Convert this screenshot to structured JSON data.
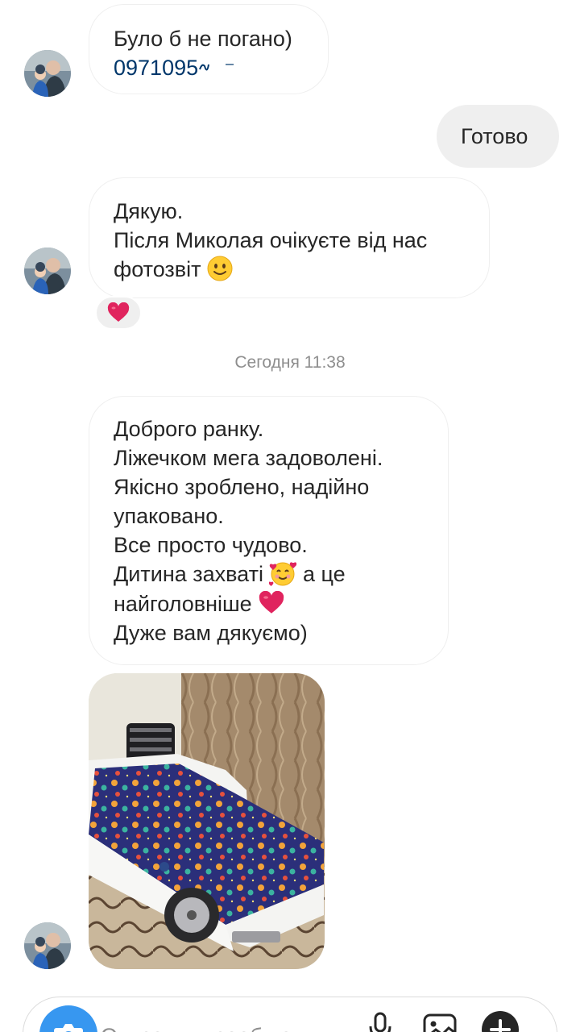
{
  "thread": {
    "messages": [
      {
        "direction": "incoming",
        "lines": [
          "Було б не погано)"
        ],
        "phone_visible": "0971095"
      },
      {
        "direction": "outgoing",
        "text": "Готово"
      },
      {
        "direction": "incoming",
        "lines": [
          "Дякую.",
          "Після Миколая очікуєте від нас",
          "фотозвіт"
        ],
        "emoji": "slightly-smiling-face",
        "reaction": "red-heart"
      },
      {
        "direction": "incoming",
        "lines": [
          "Доброго ранку.",
          "Ліжечком мега задоволені.",
          "Якісно зроблено, надійно",
          "упаковано.",
          "Все просто чудово.",
          "Дитина захваті",
          "а це",
          "найголовніше",
          "Дуже вам дякуємо)"
        ]
      },
      {
        "direction": "incoming",
        "type": "photo",
        "subject": "car-shaped-bed"
      }
    ],
    "timestamp": "Сегодня 11:38"
  },
  "composer": {
    "placeholder": "Отправить сообщени",
    "icons": [
      "camera-icon",
      "microphone-icon",
      "gallery-icon",
      "add-icon"
    ]
  },
  "colors": {
    "link": "#00376b",
    "accent": "#3797f0",
    "outgoing_bubble": "#efefef",
    "heart": "#e0245e"
  }
}
